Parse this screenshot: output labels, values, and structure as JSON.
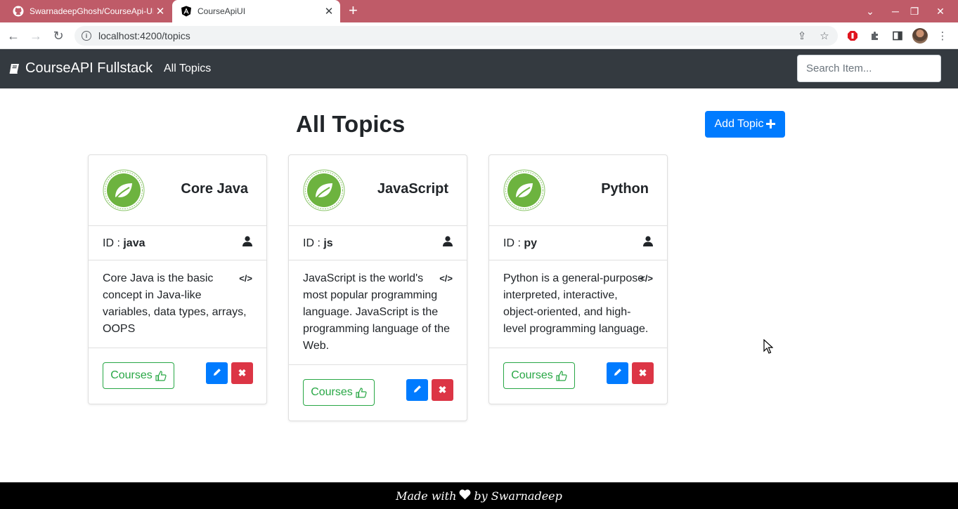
{
  "browser": {
    "tabs": [
      {
        "title": "SwarnadeepGhosh/CourseApi-UI",
        "icon": "github-icon",
        "active": false
      },
      {
        "title": "CourseApiUI",
        "icon": "angular-icon",
        "active": true
      }
    ],
    "url": "localhost:4200/topics"
  },
  "navbar": {
    "brand": "CourseAPI Fullstack",
    "link": "All Topics",
    "search_placeholder": "Search Item..."
  },
  "main": {
    "title": "All Topics",
    "add_button": "Add Topic"
  },
  "topics": [
    {
      "name": "Core Java",
      "id_label": "ID :",
      "id": "java",
      "description": "Core Java is the basic concept in Java-like variables, data types, arrays, OOPS",
      "courses_label": "Courses"
    },
    {
      "name": "JavaScript",
      "id_label": "ID :",
      "id": "js",
      "description": "JavaScript is the world's most popular programming language. JavaScript is the programming language of the Web.",
      "courses_label": "Courses"
    },
    {
      "name": "Python",
      "id_label": "ID :",
      "id": "py",
      "description": "Python is a general-purpose interpreted, interactive, object-oriented, and high-level programming language.",
      "courses_label": "Courses"
    }
  ],
  "footer": {
    "prefix": "Made with",
    "suffix": "by Swarnadeep"
  },
  "colors": {
    "tabbar": "#bf5b68",
    "navbar": "#343a40",
    "primary": "#007bff",
    "danger": "#dc3545",
    "success": "#28a745",
    "spring_green": "#6db33f"
  }
}
